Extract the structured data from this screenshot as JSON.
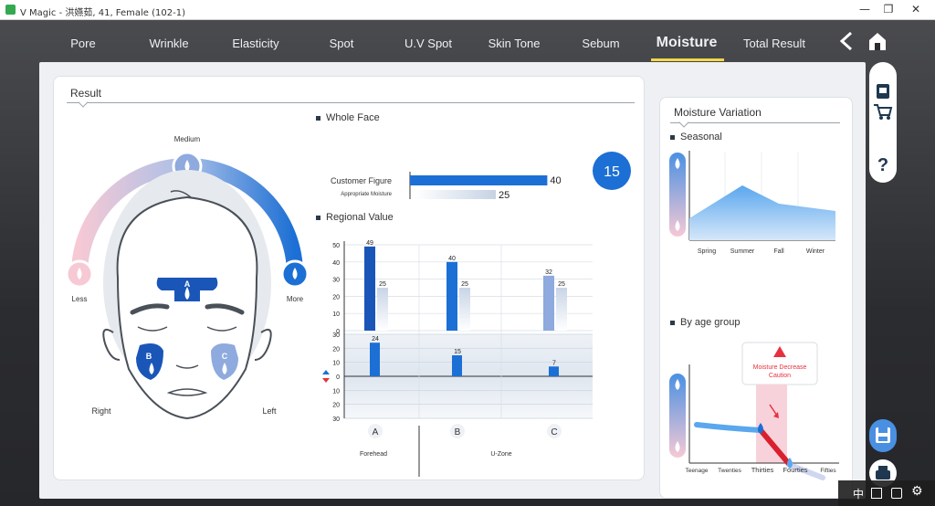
{
  "window": {
    "title": "V Magic - 洪嬿茹, 41, Female (102-1)",
    "minimize_glyph": "—",
    "restore_glyph": "❐",
    "close_glyph": "✕"
  },
  "nav": {
    "tabs": [
      {
        "label": "Pore"
      },
      {
        "label": "Wrinkle"
      },
      {
        "label": "Elasticity"
      },
      {
        "label": "Spot"
      },
      {
        "label": "U.V Spot"
      },
      {
        "label": "Skin Tone"
      },
      {
        "label": "Sebum"
      },
      {
        "label": "Moisture"
      },
      {
        "label": "Total Result"
      }
    ],
    "active_tab": "Moisture",
    "back_icon": "chevron-left-icon",
    "home_icon": "home-icon"
  },
  "result": {
    "title": "Result",
    "gauge": {
      "medium_label": "Medium",
      "less_label": "Less",
      "more_label": "More"
    },
    "face": {
      "zone_a": "A",
      "zone_b": "B",
      "zone_c": "C",
      "right_label": "Right",
      "left_label": "Left"
    },
    "whole_face": {
      "label": "Whole Face",
      "customer_label": "Customer Figure",
      "appropriate_label": "Appropriate Moisture",
      "customer_value": 40,
      "appropriate_value": 25,
      "axis_ticks": [
        0,
        10,
        20,
        30,
        40,
        50
      ],
      "score": "15"
    },
    "regional": {
      "label": "Regional Value",
      "top_ticks": [
        50,
        40,
        30,
        20,
        10,
        0
      ],
      "bottom_ticks": [
        30,
        20,
        10,
        0,
        10,
        20,
        30
      ],
      "zones": [
        {
          "letter": "A",
          "value": 49,
          "appropriate": 25,
          "diff": 24
        },
        {
          "letter": "B",
          "value": 40,
          "appropriate": 25,
          "diff": 15
        },
        {
          "letter": "C",
          "value": 32,
          "appropriate": 25,
          "diff": 7
        }
      ],
      "forehead_label": "Forehead",
      "uzone_label": "U-Zone"
    }
  },
  "variation": {
    "title": "Moisture Variation",
    "seasonal": {
      "label": "Seasonal",
      "seasons": [
        "Spring",
        "Summer",
        "Fall",
        "Winter"
      ]
    },
    "age": {
      "label": "By age group",
      "groups": [
        "Teenage",
        "Twenties",
        "Thirties",
        "Fourties",
        "Fifties"
      ],
      "callout_line1": "Moisture Decrease",
      "callout_line2": "Caution"
    }
  },
  "sidebar": {
    "icons": [
      "gallery-icon",
      "cart-icon",
      "help-icon",
      "save-icon",
      "print-icon"
    ]
  },
  "taskbar": {
    "ime": "中"
  },
  "colors": {
    "accent_blue": "#1c6fd4",
    "light_blue": "#a8c0e8",
    "gauge_pink": "#f6c9d5",
    "tab_underline": "#f3d64a",
    "warning_red": "#e8313f"
  }
}
